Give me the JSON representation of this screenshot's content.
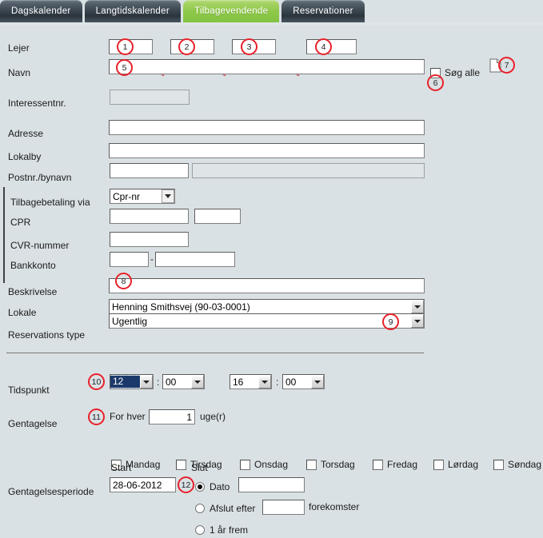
{
  "tabs": [
    {
      "label": "Dagskalender",
      "active": false
    },
    {
      "label": "Langtidskalender",
      "active": false
    },
    {
      "label": "Tilbagevendende",
      "active": true
    },
    {
      "label": "Reservationer",
      "active": false
    }
  ],
  "labels": {
    "lejer": "Lejer",
    "navn": "Navn",
    "interessentnr": "Interessentnr.",
    "adresse": "Adresse",
    "lokalby": "Lokalby",
    "postnr_bynavn": "Postnr./bynavn",
    "tilbagebetaling_via": "Tilbagebetaling via",
    "cpr": "CPR",
    "cvr_nummer": "CVR-nummer",
    "bankkonto": "Bankkonto",
    "beskrivelse": "Beskrivelse",
    "lokale": "Lokale",
    "reservations_type": "Reservations type",
    "tidspunkt": "Tidspunkt",
    "gentagelse": "Gentagelse",
    "gentagelsesperiode": "Gentagelsesperiode",
    "start": "Start",
    "slut": "Slut",
    "for_hver": "For hver",
    "uger": "uge(r)",
    "soeg_alle": "Søg alle",
    "dato": "Dato",
    "afslut_efter": "Afslut efter",
    "forekomster": "forekomster",
    "et_aar_frem": "1 år frem",
    "bankkonto_sep": "-",
    "time_sep": ":"
  },
  "fields": {
    "lejer_1": "",
    "lejer_2": "",
    "lejer_3": "",
    "lejer_4": "",
    "navn": "",
    "interessentnr": "",
    "adresse": "",
    "lokalby": "",
    "postnr": "",
    "bynavn": "",
    "tilbagebetaling_via": "Cpr-nr",
    "cpr_1": "",
    "cpr_2": "",
    "cvr_nummer": "",
    "bankkonto_reg": "",
    "bankkonto_nr": "",
    "beskrivelse": "",
    "lokale": "Henning Smithsvej (90-03-0001)",
    "reservations_type": "Ugentlig",
    "tid_start_time": "12",
    "tid_start_min": "00",
    "tid_slut_time": "16",
    "tid_slut_min": "00",
    "for_hver_antal": "1",
    "start_dato": "28-06-2012",
    "slut_dato": "",
    "afslut_efter_antal": ""
  },
  "weekdays": [
    {
      "label": "Mandag",
      "checked": false
    },
    {
      "label": "Tirsdag",
      "checked": false
    },
    {
      "label": "Onsdag",
      "checked": false
    },
    {
      "label": "Torsdag",
      "checked": false
    },
    {
      "label": "Fredag",
      "checked": false
    },
    {
      "label": "Lørdag",
      "checked": false
    },
    {
      "label": "Søndag",
      "checked": false
    }
  ],
  "annotations": [
    {
      "n": "1"
    },
    {
      "n": "2"
    },
    {
      "n": "3"
    },
    {
      "n": "4"
    },
    {
      "n": "5"
    },
    {
      "n": "6"
    },
    {
      "n": "7"
    },
    {
      "n": "8"
    },
    {
      "n": "9"
    },
    {
      "n": "10"
    },
    {
      "n": "11"
    },
    {
      "n": "12"
    }
  ],
  "icons": {
    "search": "search-icon",
    "document": "document-icon"
  },
  "colors": {
    "background": "#dae1e4",
    "tab_active": "#8ec84a",
    "tab_inactive": "#3c4750",
    "annotation": "#e8202a",
    "selection": "#1b3a6b"
  }
}
